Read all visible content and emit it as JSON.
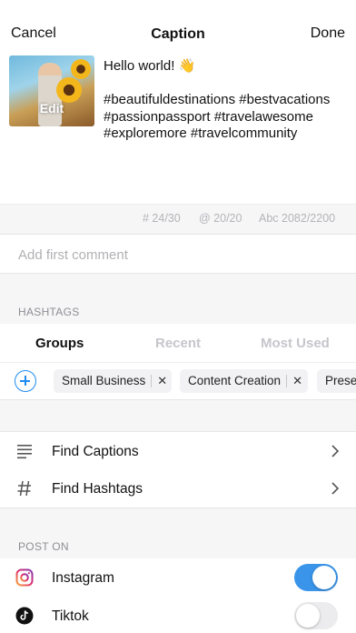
{
  "nav": {
    "cancel_label": "Cancel",
    "title": "Caption",
    "done_label": "Done"
  },
  "post": {
    "thumbnail_edit_label": "Edit",
    "caption": "Hello world! 👋\n\n#beautifuldestinations #bestvacations #passionpassport #travelawesome #exploremore #travelcommunity"
  },
  "counters": {
    "hashtags": "# 24/30",
    "mentions": "@ 20/20",
    "characters": "Abc 2082/2200"
  },
  "comment": {
    "placeholder": "Add first comment",
    "value": ""
  },
  "hashtags_section": {
    "label": "HASHTAGS",
    "tabs": [
      {
        "label": "Groups",
        "active": true
      },
      {
        "label": "Recent",
        "active": false
      },
      {
        "label": "Most Used",
        "active": false
      }
    ],
    "chips": [
      {
        "label": "Small Business"
      },
      {
        "label": "Content Creation"
      },
      {
        "label": "Prese"
      }
    ]
  },
  "tools": [
    {
      "label": "Find Captions",
      "icon": "text-lines-icon"
    },
    {
      "label": "Find Hashtags",
      "icon": "hashtag-icon"
    }
  ],
  "post_on": {
    "label": "POST ON",
    "platforms": [
      {
        "label": "Instagram",
        "icon": "instagram-icon",
        "enabled": true
      },
      {
        "label": "Tiktok",
        "icon": "tiktok-icon",
        "enabled": false
      }
    ]
  },
  "colors": {
    "accent": "#1c8cf0",
    "toggle_on": "#3a95ea",
    "section_bg": "#f6f6f7"
  }
}
